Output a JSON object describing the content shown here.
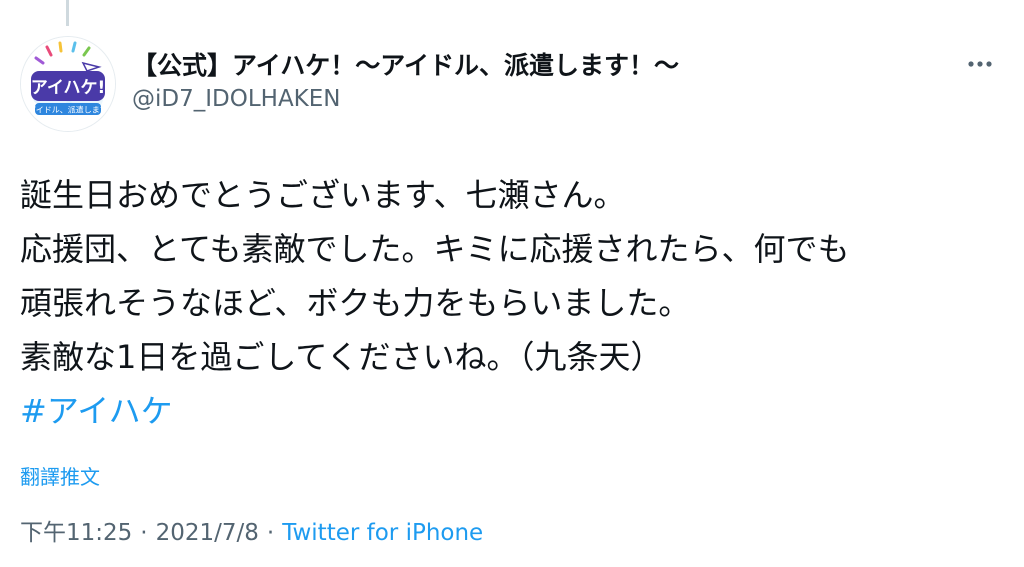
{
  "account": {
    "display_name": "【公式】アイハケ！～アイドル、派遣します！～",
    "handle": "@iD7_IDOLHAKEN",
    "avatar_logo_text": "アイハケ!",
    "avatar_logo_subtext": "アイドル、派遣します"
  },
  "tweet": {
    "lines": [
      "誕生日おめでとうございます、七瀬さん。",
      "応援団、とても素敵でした。キミに応援されたら、何でも",
      "頑張れそうなほど、ボクも力をもらいました。",
      "素敵な1日を過ごしてくださいね。（九条天）"
    ],
    "hashtag": "#アイハケ",
    "translate_label": "翻譯推文",
    "time": "下午11:25",
    "separator": "·",
    "date": "2021/7/8",
    "source": "Twitter for iPhone"
  },
  "colors": {
    "link": "#1d9bf0",
    "secondary_text": "#536471",
    "primary_text": "#0f1419"
  },
  "icons": {
    "more": "more-horizontal-icon"
  }
}
